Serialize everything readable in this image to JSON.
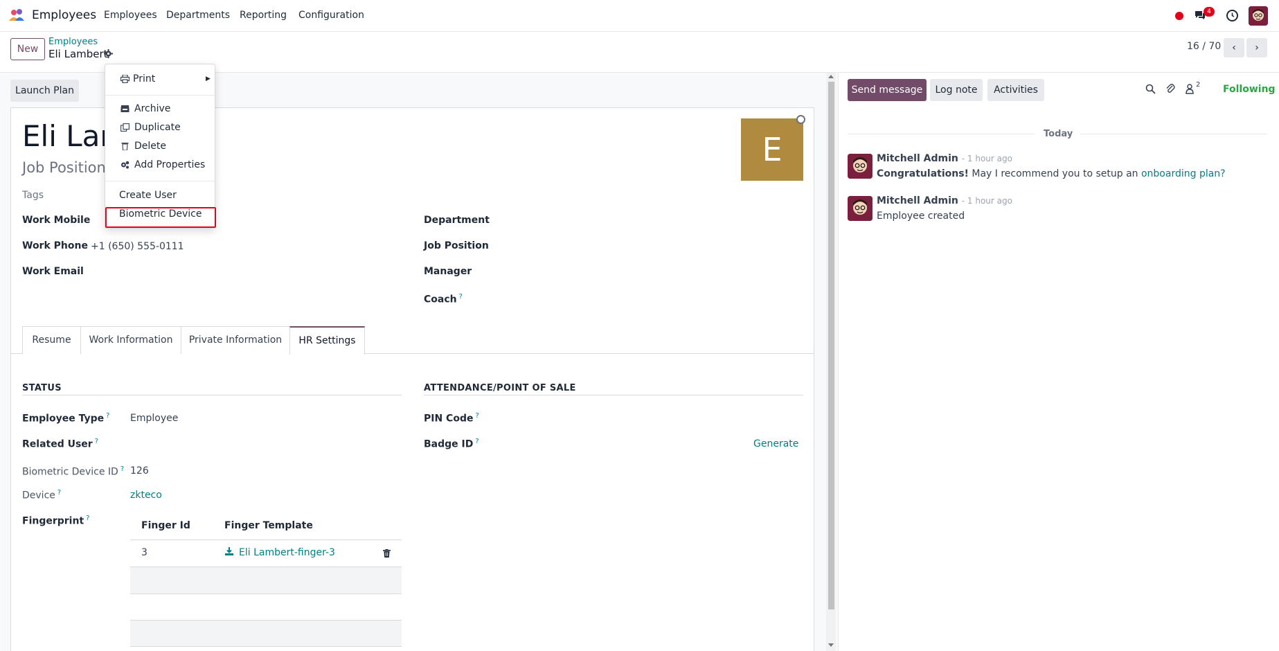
{
  "navbar": {
    "app_name": "Employees",
    "menu": [
      "Employees",
      "Departments",
      "Reporting",
      "Configuration"
    ],
    "messages_badge": "4"
  },
  "control_panel": {
    "new_label": "New",
    "breadcrumb_parent": "Employees",
    "breadcrumb_current": "Eli Lambert",
    "pager": "16 / 70",
    "launch_plan_label": "Launch Plan"
  },
  "dropdown": {
    "print": "Print",
    "archive": "Archive",
    "duplicate": "Duplicate",
    "delete": "Delete",
    "add_properties": "Add Properties",
    "create_user": "Create User",
    "biometric_device": "Biometric Device"
  },
  "employee": {
    "name": "Eli Lam",
    "job_position_placeholder": "Job Position",
    "tags_label": "Tags",
    "avatar_letter": "E",
    "avatar_color": "#b08a3e"
  },
  "fields_left": {
    "work_mobile": "Work Mobile",
    "work_phone": "Work Phone",
    "work_phone_value": "+1 (650) 555-0111",
    "work_email": "Work Email"
  },
  "fields_right": {
    "department": "Department",
    "job_position": "Job Position",
    "manager": "Manager",
    "coach": "Coach"
  },
  "tabs": [
    "Resume",
    "Work Information",
    "Private Information",
    "HR Settings"
  ],
  "hr_settings": {
    "status_title": "STATUS",
    "employee_type_label": "Employee Type",
    "employee_type_value": "Employee",
    "related_user_label": "Related User",
    "biometric_id_label": "Biometric Device ID",
    "biometric_id_value": "126",
    "device_label": "Device",
    "device_value": "zkteco",
    "fingerprint_label": "Fingerprint",
    "fingerprint_table": {
      "headers": [
        "Finger Id",
        "Finger Template"
      ],
      "rows": [
        {
          "finger_id": "3",
          "template": "Eli Lambert-finger-3"
        }
      ]
    },
    "attendance_title": "ATTENDANCE/POINT OF SALE",
    "pin_label": "PIN Code",
    "badge_label": "Badge ID",
    "generate_label": "Generate"
  },
  "chatter": {
    "send_message": "Send message",
    "log_note": "Log note",
    "activities": "Activities",
    "followers_count": "2",
    "following": "Following",
    "today": "Today",
    "messages": [
      {
        "author": "Mitchell Admin",
        "time": "- 1 hour ago",
        "body_bold": "Congratulations!",
        "body": " May I recommend you to setup an ",
        "link": "onboarding plan?"
      },
      {
        "author": "Mitchell Admin",
        "time": "- 1 hour ago",
        "body": "Employee created"
      }
    ]
  },
  "colors": {
    "brand": "#714b67",
    "link": "#017e84",
    "following": "#28a745",
    "alert": "#e3001b"
  }
}
